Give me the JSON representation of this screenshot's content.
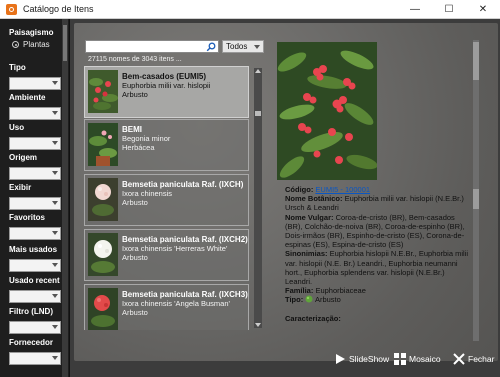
{
  "window": {
    "title": "Catálogo de Itens",
    "minimize": "—",
    "maximize": "☐",
    "close": "✕"
  },
  "sidebar": {
    "section_title": "Paisagismo",
    "radio_label": "Plantas",
    "groups": [
      "Tipo",
      "Ambiente",
      "Uso",
      "Origem",
      "Exibir",
      "Favoritos",
      "Mais usados",
      "Usado recent",
      "Filtro (LND)",
      "Fornecedor"
    ]
  },
  "search": {
    "value": "",
    "filter": "Todos",
    "count": "27115 nomes de 3043 itens ..."
  },
  "items": [
    {
      "name": "Bem-casados (EUMI5)",
      "scientific": "Euphorbia milii var. hislopii",
      "type": "Arbusto",
      "selected": true
    },
    {
      "name": "BEMI",
      "scientific": "Begonia minor",
      "type": "Herbácea",
      "selected": false
    },
    {
      "name": "Bemsetia paniculata Raf. (IXCH)",
      "scientific": "Ixora chinensis",
      "type": "Arbusto",
      "selected": false
    },
    {
      "name": "Bemsetia paniculata Raf. (IXCH2)",
      "scientific": "Ixora chinensis 'Herreras White'",
      "type": "Arbusto",
      "selected": false
    },
    {
      "name": "Bemsetia paniculata Raf. (IXCH3)",
      "scientific": "Ixora chinensis 'Angela Busman'",
      "type": "Arbusto",
      "selected": false
    }
  ],
  "details": {
    "code_label": "Código:",
    "code_value": "EUMI5 - 100001",
    "botanic_label": "Nome Botânico:",
    "botanic_value": "Euphorbia milii var. hislopii (N.E.Br.) Ursch & Leandri",
    "common_label": "Nome Vulgar:",
    "common_value": "Coroa-de-cristo (BR), Bem-casados (BR), Colchão-de-noiva (BR), Coroa-de-espinho (BR), Dois-irmãos (BR), Espinho-de-cristo (ES), Corona-de-espinas (ES), Espina-de-cristo (ES)",
    "synonyms_label": "Sinonimias:",
    "synonyms_value": "Euphorbia hislopii N.E.Br., Euphorbia milii var. hislopii (N.E. Br.) Leandri., Euphorbia neumanni hort., Euphorbia splendens var. hislopii (N.E.Br.) Leandri.",
    "family_label": "Família:",
    "family_value": "Euphorbiaceae",
    "type_label": "Tipo:",
    "type_value": "Arbusto",
    "char_label": "Caracterização:"
  },
  "buttons": {
    "slideshow": "SlideShow",
    "mosaic": "Mosaico",
    "close": "Fechar"
  },
  "colors": {
    "accent_icon": "#e8731a",
    "link": "#0a56c2",
    "flower": "#e8454f"
  }
}
